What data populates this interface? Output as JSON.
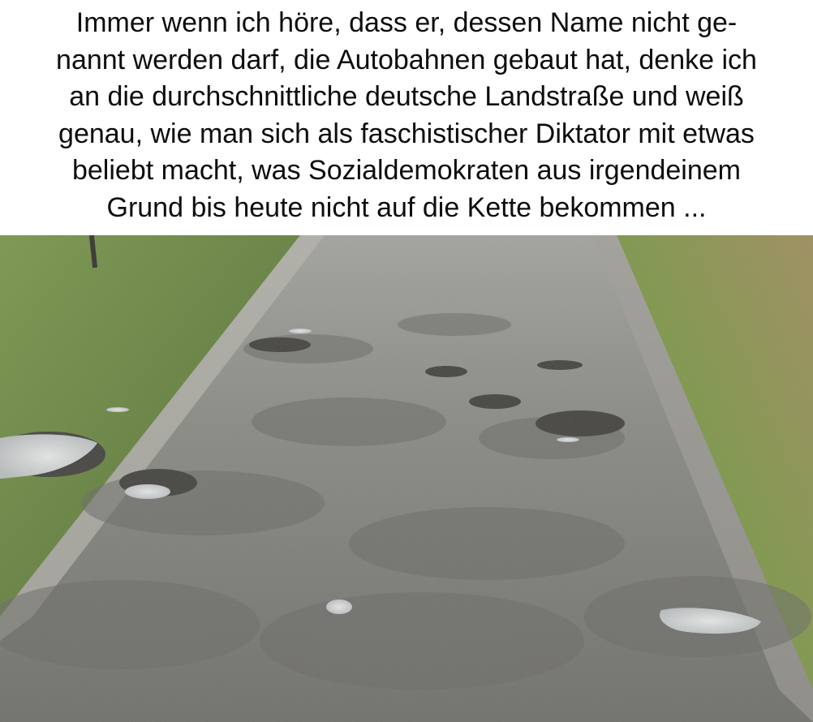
{
  "caption": {
    "lines": [
      "Immer wenn ich höre, dass er, dessen Name nicht ge-",
      "nannt werden darf, die Autobahnen gebaut hat, denke ich",
      "an die durchschnittliche deutsche Landstraße und weiß",
      "genau, wie man sich als faschistischer Diktator mit etwas",
      "beliebt macht, was Sozialdemokraten aus irgendeinem",
      "Grund bis heute nicht auf die Kette bekommen ..."
    ]
  },
  "photo": {
    "subject": "potholed-country-road",
    "colors": {
      "grass": "#6f8f3f",
      "grass_dry": "#9a8a52",
      "asphalt": "#8c8c86",
      "asphalt_dark": "#55544f",
      "puddle": "#d9dcdc"
    }
  }
}
